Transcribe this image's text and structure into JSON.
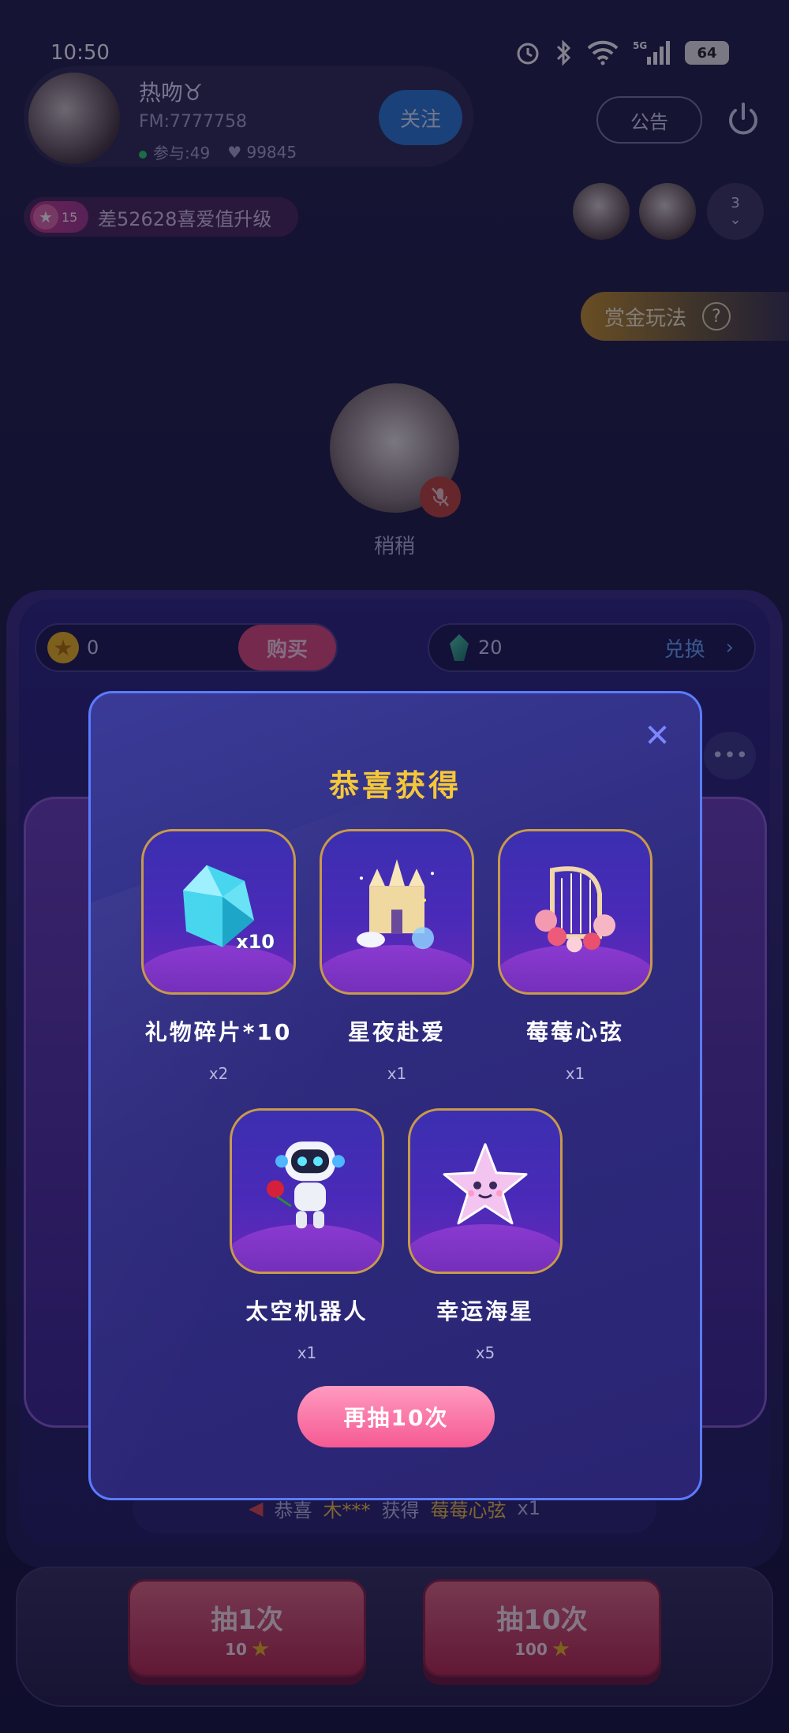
{
  "status_bar": {
    "time": "10:50",
    "battery": "64"
  },
  "host": {
    "name": "热吻♉",
    "fm": "FM:7777758",
    "participants": "参与:49",
    "likes": "99845",
    "follow_label": "关注"
  },
  "header": {
    "notice_label": "公告"
  },
  "level": {
    "badge": "15",
    "text": "差52628喜爱值升级"
  },
  "viewers": {
    "count": "3"
  },
  "bounty": {
    "label": "赏金玩法",
    "help": "?"
  },
  "mic": {
    "name": "稍稍"
  },
  "wallet": {
    "stars": "0",
    "buy_label": "购买",
    "shards": "20",
    "exchange_label": "兑换"
  },
  "ticker": {
    "prefix": "恭喜",
    "user": "木***",
    "action": "获得",
    "prize": "莓莓心弦",
    "qty": "x1"
  },
  "draw_buttons": [
    {
      "label": "抽1次",
      "cost": "10"
    },
    {
      "label": "抽10次",
      "cost": "100"
    }
  ],
  "modal": {
    "title": "恭喜获得",
    "close": "✕",
    "again_label": "再抽10次",
    "prizes": [
      {
        "name": "礼物碎片*10",
        "qty": "x2",
        "tag": "x10",
        "icon": "crystal-shard-icon"
      },
      {
        "name": "星夜赴爱",
        "qty": "x1",
        "icon": "castle-carriage-icon"
      },
      {
        "name": "莓莓心弦",
        "qty": "x1",
        "icon": "harp-flowers-icon"
      },
      {
        "name": "太空机器人",
        "qty": "x1",
        "icon": "robot-rose-icon"
      },
      {
        "name": "幸运海星",
        "qty": "x5",
        "icon": "starfish-icon"
      }
    ]
  },
  "colors": {
    "accent": "#f4c838",
    "modal_border": "#5a7cff",
    "pink_button": "#f55a92",
    "follow": "#2b7ad4"
  }
}
